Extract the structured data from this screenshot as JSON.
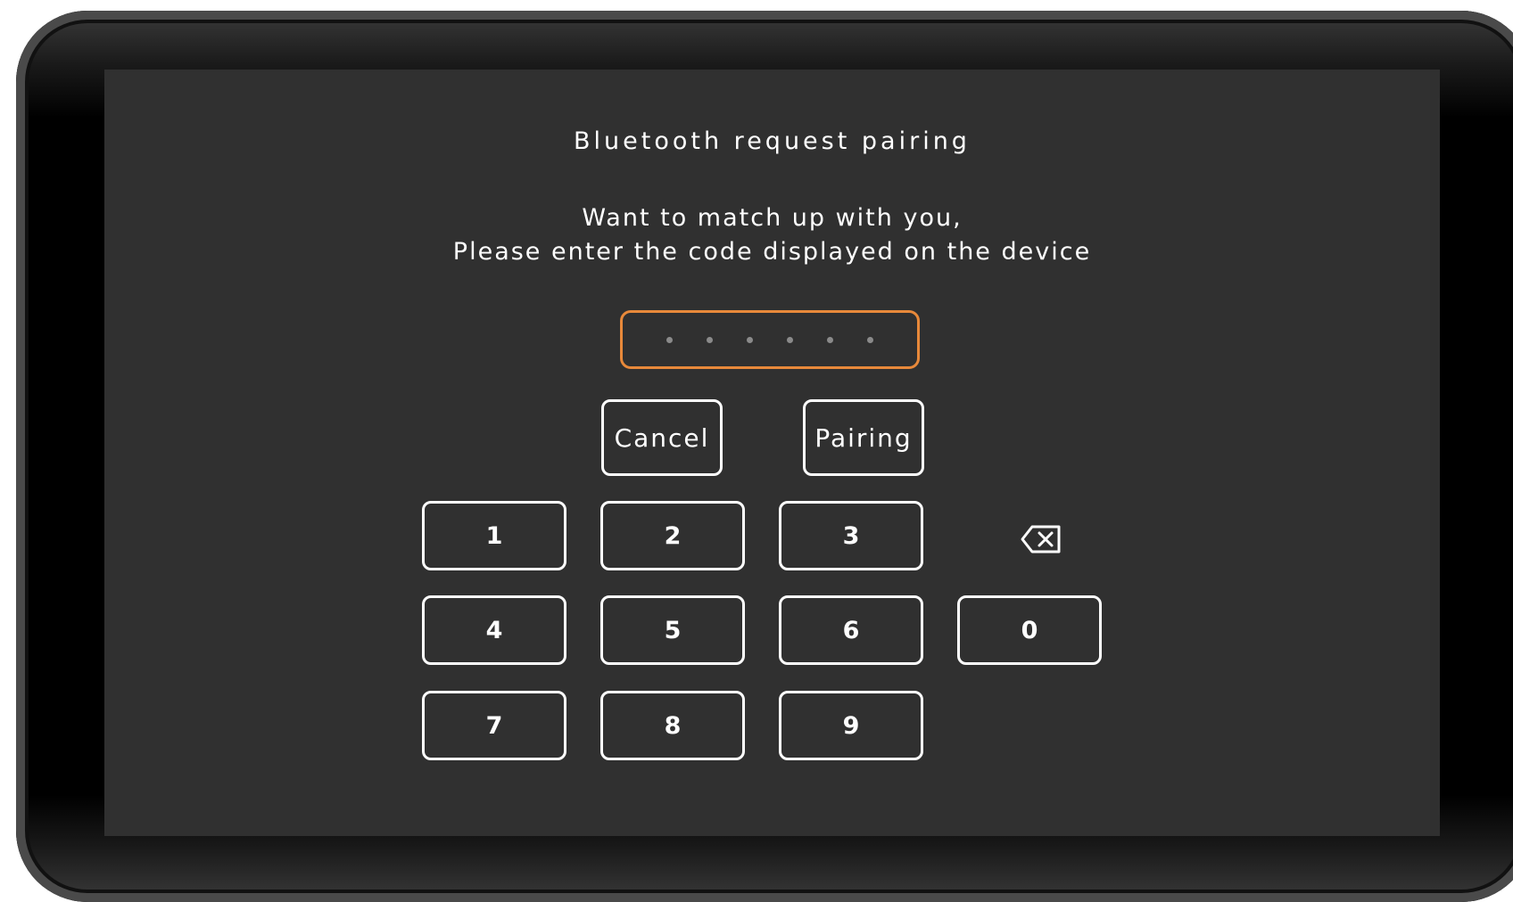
{
  "dialog": {
    "title": "Bluetooth request pairing",
    "message_line1": "Want to match up with you,",
    "message_line2": "Please enter the code displayed on the device"
  },
  "code_input": {
    "digits_entered": 0,
    "placeholder_dots": 6,
    "border_color": "#e8893a"
  },
  "actions": {
    "cancel_label": "Cancel",
    "pairing_label": "Pairing"
  },
  "keypad": {
    "keys": [
      "1",
      "2",
      "3",
      "4",
      "5",
      "6",
      "0",
      "7",
      "8",
      "9"
    ],
    "backspace_icon": "backspace-icon"
  },
  "colors": {
    "screen_background": "#303030",
    "text": "#ffffff",
    "accent": "#e8893a"
  }
}
